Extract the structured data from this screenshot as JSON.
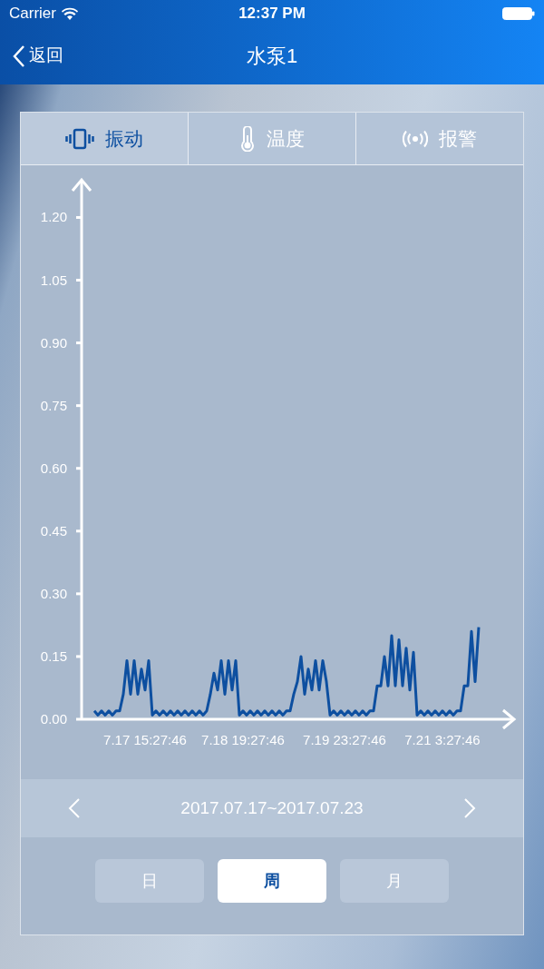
{
  "status_bar": {
    "carrier": "Carrier",
    "time": "12:37 PM"
  },
  "nav": {
    "back": "返回",
    "title": "水泵1"
  },
  "tabs": [
    {
      "label": "振动",
      "selected": true
    },
    {
      "label": "温度",
      "selected": false
    },
    {
      "label": "报警",
      "selected": false
    }
  ],
  "chart": {
    "chart_data": {
      "type": "line",
      "ylim": [
        0,
        1.29
      ],
      "categories": [
        null,
        null,
        null,
        null,
        null,
        null,
        null,
        null,
        null,
        null,
        null,
        null,
        null,
        null,
        "7.17 15:27:46",
        null,
        null,
        null,
        null,
        null,
        null,
        null,
        null,
        null,
        null,
        null,
        null,
        null,
        null,
        null,
        null,
        null,
        null,
        null,
        null,
        null,
        null,
        null,
        null,
        null,
        null,
        "7.18 19:27:46",
        null,
        null,
        null,
        null,
        null,
        null,
        null,
        null,
        null,
        null,
        null,
        null,
        null,
        null,
        null,
        null,
        null,
        null,
        null,
        null,
        null,
        null,
        null,
        null,
        null,
        null,
        null,
        "7.19 23:27:46",
        null,
        null,
        null,
        null,
        null,
        null,
        null,
        null,
        null,
        null,
        null,
        null,
        null,
        null,
        null,
        null,
        null,
        null,
        null,
        null,
        null,
        null,
        null,
        null,
        null,
        null,
        "7.21 3:27:46",
        null,
        null,
        null,
        null,
        null,
        null,
        null,
        null,
        null,
        null
      ],
      "yticks": [
        {
          "value": 0,
          "label": "0.00"
        },
        {
          "value": 0.15,
          "label": "0.15"
        },
        {
          "value": 0.3,
          "label": "0.30"
        },
        {
          "value": 0.45,
          "label": "0.45"
        },
        {
          "value": 0.6,
          "label": "0.60"
        },
        {
          "value": 0.75,
          "label": "0.75"
        },
        {
          "value": 0.9,
          "label": "0.90"
        },
        {
          "value": 1.05,
          "label": "1.05"
        },
        {
          "value": 1.2,
          "label": "1.20"
        }
      ],
      "series": [
        {
          "color": "#0d4fa0",
          "values": [
            0.02,
            0.01,
            0.02,
            0.01,
            0.02,
            0.01,
            0.02,
            0.02,
            0.06,
            0.14,
            0.06,
            0.14,
            0.06,
            0.12,
            0.07,
            0.14,
            0.01,
            0.02,
            0.01,
            0.02,
            0.01,
            0.02,
            0.01,
            0.02,
            0.01,
            0.02,
            0.01,
            0.02,
            0.01,
            0.02,
            0.01,
            0.02,
            0.06,
            0.11,
            0.07,
            0.14,
            0.06,
            0.14,
            0.07,
            0.14,
            0.01,
            0.02,
            0.01,
            0.02,
            0.01,
            0.02,
            0.01,
            0.02,
            0.01,
            0.02,
            0.01,
            0.02,
            0.01,
            0.02,
            0.02,
            0.06,
            0.09,
            0.15,
            0.06,
            0.12,
            0.07,
            0.14,
            0.07,
            0.14,
            0.09,
            0.01,
            0.02,
            0.01,
            0.02,
            0.01,
            0.02,
            0.01,
            0.02,
            0.01,
            0.02,
            0.01,
            0.02,
            0.02,
            0.08,
            0.08,
            0.15,
            0.08,
            0.2,
            0.08,
            0.19,
            0.08,
            0.17,
            0.07,
            0.16,
            0.01,
            0.02,
            0.01,
            0.02,
            0.01,
            0.02,
            0.01,
            0.02,
            0.01,
            0.02,
            0.01,
            0.02,
            0.02,
            0.08,
            0.08,
            0.21,
            0.09,
            0.22
          ]
        }
      ]
    }
  },
  "date_range": {
    "label": "2017.07.17~2017.07.23"
  },
  "periods": [
    {
      "label": "日",
      "selected": false
    },
    {
      "label": "周",
      "selected": true
    },
    {
      "label": "月",
      "selected": false
    }
  ]
}
